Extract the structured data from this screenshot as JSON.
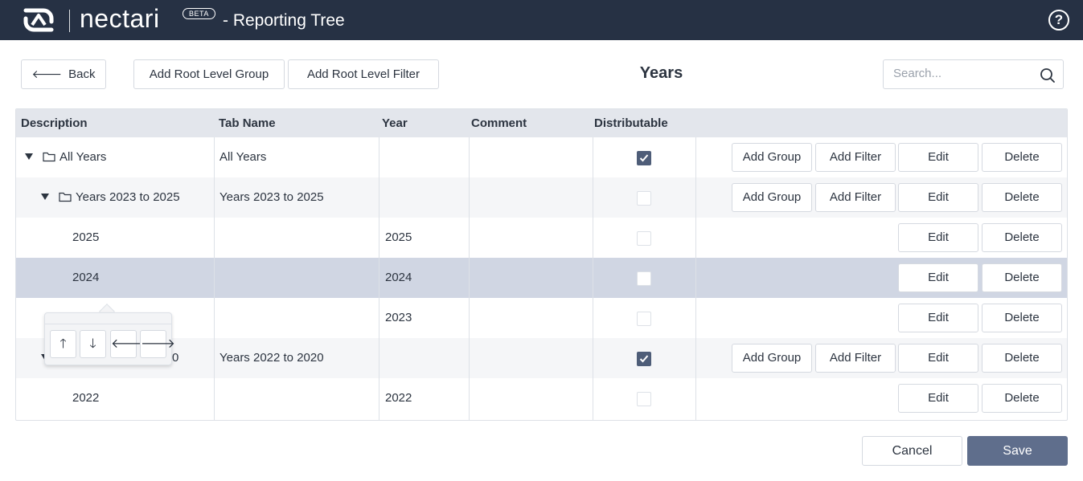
{
  "header": {
    "brand": "nectari",
    "beta_badge": "BETA",
    "title": "- Reporting Tree",
    "help_icon": "?"
  },
  "toolbar": {
    "back_label": "Back",
    "add_root_group_label": "Add Root Level Group",
    "add_root_filter_label": "Add Root Level Filter",
    "heading": "Years",
    "search_placeholder": "Search..."
  },
  "table": {
    "columns": [
      "Description",
      "Tab Name",
      "Year",
      "Comment",
      "Distributable"
    ],
    "rows": [
      {
        "description": "All Years",
        "tab_name": "All Years",
        "year": "",
        "comment": "",
        "distributable": true,
        "actions": [
          "Add Group",
          "Add Filter",
          "Edit",
          "Delete"
        ]
      },
      {
        "description": "Years 2023 to 2025",
        "tab_name": "Years 2023 to 2025",
        "year": "",
        "comment": "",
        "distributable": false,
        "actions": [
          "Add Group",
          "Add Filter",
          "Edit",
          "Delete"
        ]
      },
      {
        "description": "2025",
        "tab_name": "",
        "year": "2025",
        "comment": "",
        "distributable": false,
        "actions": [
          "Edit",
          "Delete"
        ]
      },
      {
        "description": "2024",
        "tab_name": "",
        "year": "2024",
        "comment": "",
        "distributable": false,
        "actions": [
          "Edit",
          "Delete"
        ]
      },
      {
        "description": "",
        "tab_name": "",
        "year": "2023",
        "comment": "",
        "distributable": false,
        "actions": [
          "Edit",
          "Delete"
        ]
      },
      {
        "description": "0",
        "tab_name": "Years 2022 to 2020",
        "year": "",
        "comment": "",
        "distributable": true,
        "actions": [
          "Add Group",
          "Add Filter",
          "Edit",
          "Delete"
        ]
      },
      {
        "description": "2022",
        "tab_name": "",
        "year": "2022",
        "comment": "",
        "distributable": false,
        "actions": [
          "Edit",
          "Delete"
        ]
      }
    ]
  },
  "move_popover": {
    "buttons": [
      "arrow-up-icon",
      "arrow-down-icon",
      "arrow-left-icon",
      "arrow-right-icon"
    ]
  },
  "footer": {
    "cancel_label": "Cancel",
    "save_label": "Save"
  },
  "colors": {
    "topbar": "#263144",
    "header_row": "#e3e6ec",
    "selected_row": "#d0d6e3",
    "checkbox_checked": "#4e5d78",
    "save_button": "#5f6e8c"
  }
}
